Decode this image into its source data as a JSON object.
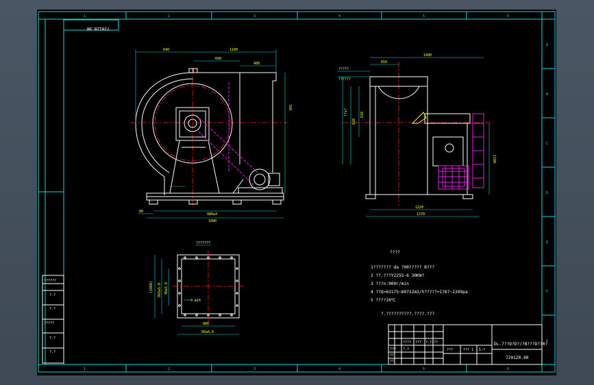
{
  "colors": {
    "viewport": "#4a5663",
    "sheet": "#000000",
    "frame": "#00e0e0",
    "centerline": "#ff2020",
    "geometry": "#ffffff",
    "hidden": "#e020e0",
    "accent": "#ffff00"
  },
  "zones_top": [
    "1",
    "2",
    "3",
    "4",
    "5",
    "6"
  ],
  "zones_bottom": [
    "1",
    "2",
    "3",
    "4",
    "5",
    "6"
  ],
  "zones_right": [
    "A",
    "B",
    "C",
    "D",
    "E",
    "F",
    "G"
  ],
  "drawing_number_mirrored": "7201Z0.00",
  "front_view": {
    "dims_top": [
      "640",
      "1100",
      "600",
      "480"
    ],
    "dim_right": "760",
    "dim_bottom_inner": "980±4",
    "dim_bottom_outer": "1080",
    "dim_left_foot": "80"
  },
  "side_view": {
    "dim_top": "1400",
    "dim_upper": "650",
    "dims_left": [
      "?????",
      "??????"
    ],
    "dims_side": [
      "??±?",
      "820",
      "810"
    ],
    "dim_right": "1100",
    "dim_bottom_1": "1220",
    "dim_bottom_2": "1270"
  },
  "flange_view": {
    "label": "???????",
    "dims_left": [
      "(1080)",
      "965±5.0",
      "40±5.0"
    ],
    "dim_inner": "9-ø16",
    "dim_bottom_1": "880",
    "dim_bottom_2": "96±6.0"
  },
  "notes": {
    "title": "????",
    "lines": [
      "1??????? da ?90????? B???",
      "2 ??.???Y225S-6 30KW?",
      "3 ???n:900r/min",
      "4 ??Q=63175~60732m3/h?????=1767~1399pa",
      "5 ????20℃"
    ],
    "footer": "?.??????????.????.???"
  },
  "left_block": {
    "rows": [
      "??????",
      "?.?",
      "?.?",
      "?????",
      "?.?",
      "?.?"
    ]
  },
  "title_block": {
    "drawing_title": "DL-7??D?D?/?B???D??0?",
    "drawing_number": "7201Z0.00",
    "cells": [
      "????",
      "???",
      "?.??",
      "??",
      "???",
      "??",
      "??",
      "?.?",
      "???",
      "??? 1",
      "1:?"
    ]
  }
}
